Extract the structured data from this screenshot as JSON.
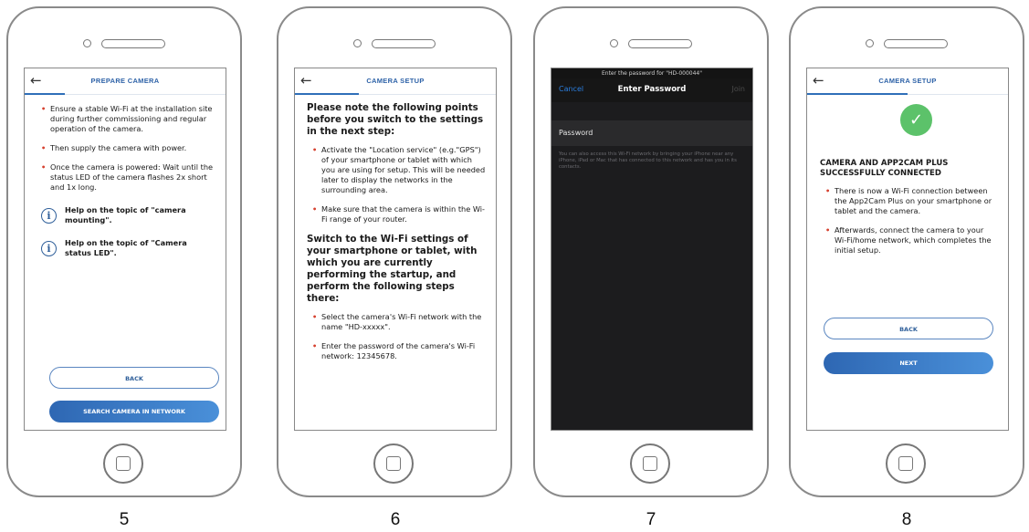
{
  "phones": [
    {
      "step": "5",
      "title": "PREPARE CAMERA",
      "bullets": [
        "Ensure a stable Wi-Fi at the installation site during further commissioning and regular operation of the camera.",
        "Then supply the camera with power.",
        "Once the camera is powered: Wait until the status LED  of the camera flashes 2x short and 1x long."
      ],
      "help_1": "Help on the topic of \"camera mounting\".",
      "help_2": "Help on the topic of \"Camera status LED\".",
      "back_label": "BACK",
      "primary_label": "SEARCH CAMERA IN NETWORK"
    },
    {
      "step": "6",
      "title": "CAMERA SETUP",
      "heading_1": "Please note the following points before you switch to the settings in the next step:",
      "bullets_1": [
        "Activate the \"Location service\" (e.g.\"GPS\") of your smartphone or tablet with which you are using for setup. This will be needed later to display the networks in the surrounding area.",
        "Make sure that the camera is within the Wi-Fi range of your router."
      ],
      "heading_2": "Switch to the Wi-Fi settings of your smartphone or tablet, with which you are currently performing the startup, and perform the following steps there:",
      "bullets_2": [
        "Select the camera's Wi-Fi network with the name \"HD-xxxxx\".",
        "Enter the password of the camera's Wi-Fi network: 12345678."
      ]
    },
    {
      "step": "7",
      "prompt": "Enter the password for \"HD-000044\"",
      "cancel": "Cancel",
      "heading": "Enter Password",
      "join": "Join",
      "field_label": "Password",
      "hint": "You can also access this Wi-Fi network by bringing your iPhone near any iPhone, iPad or Mac that has connected to this network and has you in its contacts."
    },
    {
      "step": "8",
      "title": "CAMERA SETUP",
      "check_icon": "check-icon",
      "heading": "CAMERA AND APP2CAM PLUS SUCCESSFULLY CONNECTED",
      "bullets": [
        "There is now a Wi-Fi connection between the App2Cam Plus on your smartphone or tablet and the camera.",
        "Afterwards, connect the camera to your Wi-Fi/home network, which completes the initial setup."
      ],
      "back_label": "BACK",
      "primary_label": "NEXT"
    }
  ],
  "colors": {
    "accent": "#2f63a8",
    "bullet": "#d6402e",
    "success": "#5cc26a",
    "ios_link": "#2b7fe0"
  }
}
